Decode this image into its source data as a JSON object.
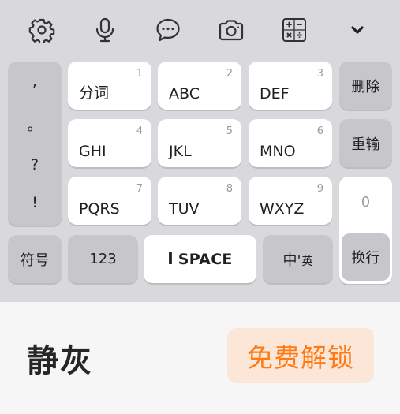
{
  "toolbar": {
    "icons": [
      "gear-icon",
      "microphone-icon",
      "chat-bubble-icon",
      "camera-icon",
      "calculator-icon",
      "chevron-down-icon"
    ]
  },
  "punctuation": [
    ",",
    "。",
    "?",
    "!"
  ],
  "keys": {
    "row1": [
      {
        "num": "1",
        "label": "分词"
      },
      {
        "num": "2",
        "label": "ABC"
      },
      {
        "num": "3",
        "label": "DEF"
      }
    ],
    "row2": [
      {
        "num": "4",
        "label": "GHI"
      },
      {
        "num": "5",
        "label": "JKL"
      },
      {
        "num": "6",
        "label": "MNO"
      }
    ],
    "row3": [
      {
        "num": "7",
        "label": "PQRS"
      },
      {
        "num": "8",
        "label": "TUV"
      },
      {
        "num": "9",
        "label": "WXYZ"
      }
    ]
  },
  "side": {
    "delete": "删除",
    "retype": "重输",
    "zero": "0",
    "enter": "换行"
  },
  "bottom": {
    "symbols": "符号",
    "numbers": "123",
    "space": "SPACE",
    "lang_main": "中'",
    "lang_sub": "英"
  },
  "footer": {
    "title": "静灰",
    "unlock": "免费解锁"
  },
  "colors": {
    "keyboard_bg": "#d9d9dd",
    "key_white": "#ffffff",
    "key_gray": "#c6c6cb",
    "unlock_text": "#ff7a14",
    "unlock_bg": "#fbe6d8"
  }
}
